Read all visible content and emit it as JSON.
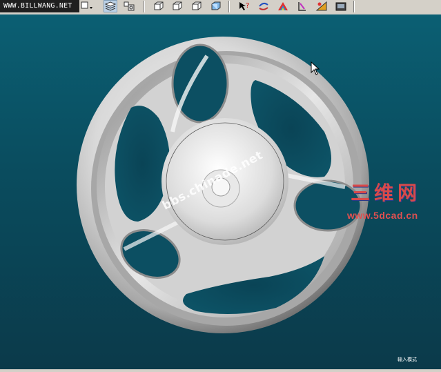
{
  "toolbar": {
    "site_label": "WWW.BILLWANG.NET",
    "buttons": [
      {
        "icon": "select-dropdown-icon"
      },
      {
        "icon": "layers-icon"
      },
      {
        "icon": "model-tree-icon"
      },
      {
        "icon": "view-front-icon"
      },
      {
        "icon": "view-isometric-icon"
      },
      {
        "icon": "view-right-icon"
      },
      {
        "icon": "shaded-cube-icon"
      },
      {
        "icon": "help-icon"
      },
      {
        "icon": "repaint-icon"
      },
      {
        "icon": "color-appearance-icon"
      },
      {
        "icon": "orient-icon"
      },
      {
        "icon": "render-icon"
      },
      {
        "icon": "save-view-icon"
      }
    ]
  },
  "viewport": {
    "background": "#0b4f62",
    "watermark_diagonal": "bbs.chinade.net",
    "logo_chinese": "三维网",
    "logo_url": "www.5dcad.cn",
    "mode_label": "输入模式"
  },
  "colors": {
    "toolbar": "#d4d0c8",
    "viewport_top": "#0b5f73",
    "viewport_bottom": "#0b3a4a",
    "logo_red": "#d84a4a"
  }
}
